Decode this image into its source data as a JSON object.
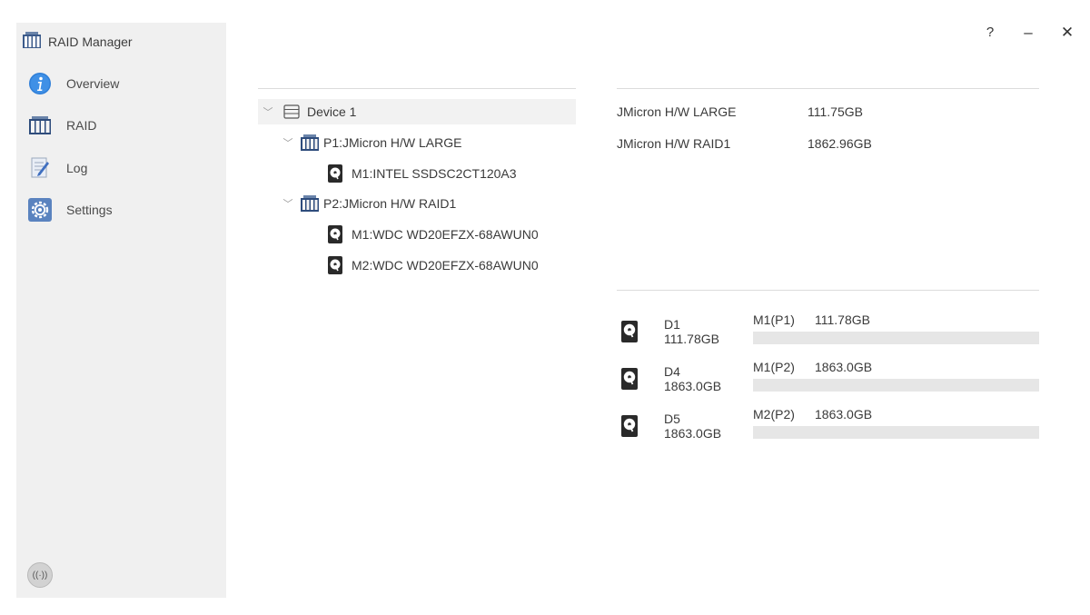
{
  "app": {
    "title": "RAID Manager"
  },
  "window_controls": {
    "help": "?",
    "minimize": "–",
    "close": "✕"
  },
  "sidebar": {
    "items": [
      {
        "label": "Overview",
        "icon": "info-icon"
      },
      {
        "label": "RAID",
        "icon": "raid-icon"
      },
      {
        "label": "Log",
        "icon": "log-icon"
      },
      {
        "label": "Settings",
        "icon": "gear-icon"
      }
    ],
    "footer_icon": "wireless-icon"
  },
  "tree": {
    "device": {
      "label": "Device 1",
      "icon": "device-icon"
    },
    "pools": [
      {
        "label": "P1:JMicron H/W LARGE",
        "icon": "raid-icon",
        "members": [
          {
            "label": "M1:INTEL SSDSC2CT120A3",
            "icon": "hdd-icon"
          }
        ]
      },
      {
        "label": "P2:JMicron H/W RAID1",
        "icon": "raid-icon",
        "members": [
          {
            "label": "M1:WDC WD20EFZX-68AWUN0",
            "icon": "hdd-icon"
          },
          {
            "label": "M2:WDC WD20EFZX-68AWUN0",
            "icon": "hdd-icon"
          }
        ]
      }
    ]
  },
  "info": [
    {
      "name": "JMicron H/W LARGE",
      "capacity": "111.75GB"
    },
    {
      "name": "JMicron H/W RAID1",
      "capacity": "1862.96GB"
    }
  ],
  "disks": [
    {
      "name": "D1",
      "size": "111.78GB",
      "slot": "M1(P1)",
      "slot_size": "111.78GB",
      "usage": 0
    },
    {
      "name": "D4",
      "size": "1863.0GB",
      "slot": "M1(P2)",
      "slot_size": "1863.0GB",
      "usage": 0
    },
    {
      "name": "D5",
      "size": "1863.0GB",
      "slot": "M2(P2)",
      "slot_size": "1863.0GB",
      "usage": 0
    }
  ],
  "colors": {
    "sidebar_bg": "#f0f0f0",
    "accent_blue": "#2f7fd8",
    "bar_bg": "#e6e6e6"
  }
}
